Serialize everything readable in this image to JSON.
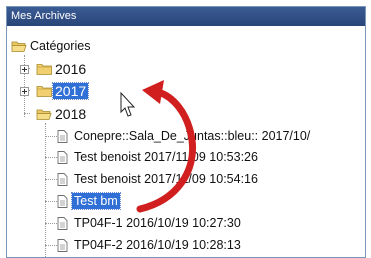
{
  "window": {
    "title": "Mes Archives"
  },
  "tree": {
    "root_label": "Catégories",
    "years": [
      {
        "label": "2016",
        "selected": false
      },
      {
        "label": "2017",
        "selected": true
      },
      {
        "label": "2018",
        "selected": false
      }
    ],
    "items": [
      {
        "label": "Conepre::Sala_De_Juntas::bleu:: 2017/10/",
        "selected": false
      },
      {
        "label": "Test benoist 2017/11/09 10:53:26",
        "selected": false
      },
      {
        "label": "Test benoist 2017/11/09 10:54:16",
        "selected": false
      },
      {
        "label": "Test bm",
        "selected": true
      },
      {
        "label": "TP04F-1 2016/10/19 10:27:30",
        "selected": false
      },
      {
        "label": "TP04F-2 2016/10/19 10:28:13",
        "selected": false
      }
    ]
  },
  "colors": {
    "selection": "#2f6fd6",
    "arrow": "#d11f1f",
    "titlebar": "#2f4f88"
  }
}
